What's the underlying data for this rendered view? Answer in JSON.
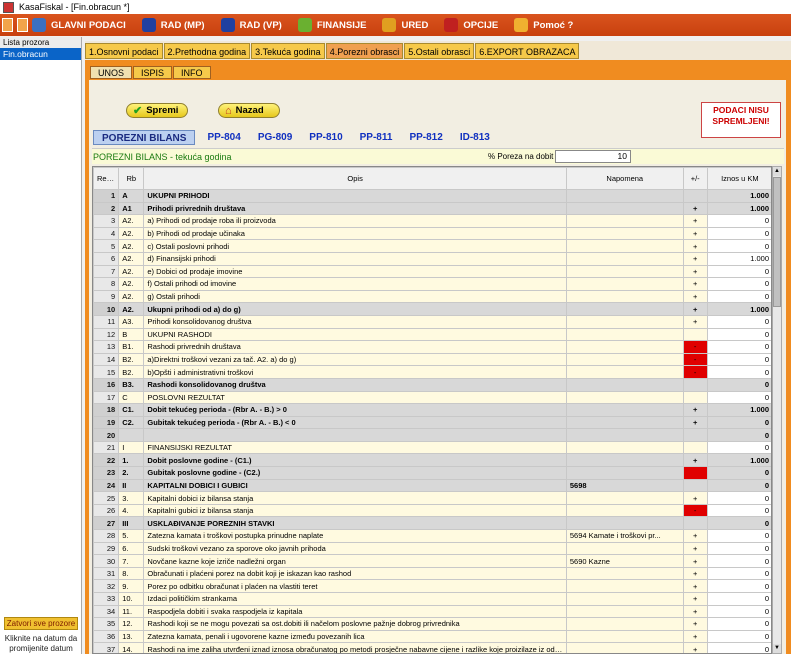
{
  "window": {
    "title": "KasaFiskal - [Fin.obracun *]"
  },
  "menu": [
    {
      "label": "GLAVNI PODACI",
      "icon": "database-icon",
      "color": "#3a70c0"
    },
    {
      "label": "RAD (MP)",
      "icon": "flag-icon",
      "color": "#2040a0"
    },
    {
      "label": "RAD (VP)",
      "icon": "flag-icon",
      "color": "#2040a0"
    },
    {
      "label": "FINANSIJE",
      "icon": "money-icon",
      "color": "#6ab030"
    },
    {
      "label": "URED",
      "icon": "folder-icon",
      "color": "#e0a020"
    },
    {
      "label": "OPCIJE",
      "icon": "gear-icon",
      "color": "#c02020"
    },
    {
      "label": "Pomoć ?",
      "icon": "help-icon",
      "color": "#f0b030"
    }
  ],
  "sidebar": {
    "header": "Lista prozora",
    "items": [
      "Fin.obracun"
    ],
    "close_all": "Zatvori sve prozore",
    "hint": "Kliknite na datum da promijenite datum"
  },
  "tabs_main": [
    "1.Osnovni podaci",
    "2.Prethodna godina",
    "3.Tekuća godina",
    "4.Porezni obrasci",
    "5.Ostali obrasci",
    "6.EXPORT OBRAZACA"
  ],
  "tabs_sub": [
    "UNOS",
    "ISPIS",
    "INFO"
  ],
  "buttons": {
    "save": "Spremi",
    "back": "Nazad"
  },
  "warning": "PODACI NISU SPREMLJENI!",
  "forms": [
    "POREZNI BILANS",
    "PP-804",
    "PG-809",
    "PP-810",
    "PP-811",
    "PP-812",
    "ID-813"
  ],
  "section_title": "POREZNI BILANS - tekuća godina",
  "tax_rate": {
    "label": "% Poreza na dobit",
    "value": "10"
  },
  "columns": {
    "red_br": "Red br.",
    "rb": "Rb",
    "opis": "Opis",
    "napomena": "Napomena",
    "pm": "+/-",
    "iznos": "Iznos u KM"
  },
  "rows": [
    {
      "n": "1",
      "rb": "A",
      "opis": "UKUPNI PRIHODI",
      "napomena": "",
      "pm": "",
      "iznos": "1.000",
      "bold": true
    },
    {
      "n": "2",
      "rb": "A1",
      "opis": "Prihodi privrednih društava",
      "napomena": "",
      "pm": "+",
      "iznos": "1.000",
      "bold": true
    },
    {
      "n": "3",
      "rb": "A2.",
      "opis": "a) Prihodi od prodaje roba ili proizvoda",
      "napomena": "",
      "pm": "+",
      "iznos": "0"
    },
    {
      "n": "4",
      "rb": "A2.",
      "opis": "b) Prihodi od prodaje učinaka",
      "napomena": "",
      "pm": "+",
      "iznos": "0"
    },
    {
      "n": "5",
      "rb": "A2.",
      "opis": "c) Ostali poslovni prihodi",
      "napomena": "",
      "pm": "+",
      "iznos": "0"
    },
    {
      "n": "6",
      "rb": "A2.",
      "opis": "d) Finansijski prihodi",
      "napomena": "",
      "pm": "+",
      "iznos": "1.000"
    },
    {
      "n": "7",
      "rb": "A2.",
      "opis": "e) Dobici od prodaje imovine",
      "napomena": "",
      "pm": "+",
      "iznos": "0"
    },
    {
      "n": "8",
      "rb": "A2.",
      "opis": "f) Ostali prihodi od imovine",
      "napomena": "",
      "pm": "+",
      "iznos": "0"
    },
    {
      "n": "9",
      "rb": "A2.",
      "opis": "g) Ostali prihodi",
      "napomena": "",
      "pm": "+",
      "iznos": "0"
    },
    {
      "n": "10",
      "rb": "A2.",
      "opis": "Ukupni prihodi  od a) do g)",
      "napomena": "",
      "pm": "+",
      "iznos": "1.000",
      "bold": true
    },
    {
      "n": "11",
      "rb": "A3.",
      "opis": "Prihodi konsolidovanog društva",
      "napomena": "",
      "pm": "+",
      "iznos": "0"
    },
    {
      "n": "12",
      "rb": "B",
      "opis": "UKUPNI RASHODI",
      "napomena": "",
      "pm": "",
      "iznos": "0"
    },
    {
      "n": "13",
      "rb": "B1.",
      "opis": "Rashodi privrednih društava",
      "napomena": "",
      "pm": "-",
      "iznos": "0",
      "red": true
    },
    {
      "n": "14",
      "rb": "B2.",
      "opis": "a)Direktni troškovi vezani za tač. A2. a) do g)",
      "napomena": "",
      "pm": "-",
      "iznos": "0",
      "red": true
    },
    {
      "n": "15",
      "rb": "B2.",
      "opis": "b)Opšti i administrativni troškovi",
      "napomena": "",
      "pm": "-",
      "iznos": "0",
      "red": true
    },
    {
      "n": "16",
      "rb": "B3.",
      "opis": "Rashodi konsolidovanog društva",
      "napomena": "",
      "pm": "",
      "iznos": "0",
      "bold": true
    },
    {
      "n": "17",
      "rb": "C",
      "opis": "POSLOVNI REZULTAT",
      "napomena": "",
      "pm": "",
      "iznos": "0"
    },
    {
      "n": "18",
      "rb": "C1.",
      "opis": "Dobit tekućeg perioda  - (Rbr A. - B.) > 0",
      "napomena": "",
      "pm": "+",
      "iznos": "1.000",
      "bold": true
    },
    {
      "n": "19",
      "rb": "C2.",
      "opis": "Gubitak tekućeg perioda  - (Rbr A. - B.) < 0",
      "napomena": "",
      "pm": "+",
      "iznos": "0",
      "bold": true
    },
    {
      "n": "20",
      "rb": "",
      "opis": "",
      "napomena": "",
      "pm": "",
      "iznos": "0",
      "bold": true
    },
    {
      "n": "21",
      "rb": "I",
      "opis": "FINANSIJSKI REZULTAT",
      "napomena": "",
      "pm": "",
      "iznos": "0"
    },
    {
      "n": "22",
      "rb": "1.",
      "opis": "Dobit poslovne godine  -     (C1.)",
      "napomena": "",
      "pm": "+",
      "iznos": "1.000",
      "bold": true
    },
    {
      "n": "23",
      "rb": "2.",
      "opis": "Gubitak poslovne godine  -     (C2.)",
      "napomena": "",
      "pm": "",
      "iznos": "0",
      "bold": true,
      "red": true
    },
    {
      "n": "24",
      "rb": "II",
      "opis": "KAPITALNI DOBICI I GUBICI",
      "napomena": "5698",
      "pm": "",
      "iznos": "0",
      "bold": true
    },
    {
      "n": "25",
      "rb": "3.",
      "opis": "Kapitalni dobici iz bilansa stanja",
      "napomena": "",
      "pm": "+",
      "iznos": "0"
    },
    {
      "n": "26",
      "rb": "4.",
      "opis": "Kapitalni gubici iz bilansa stanja",
      "napomena": "",
      "pm": "-",
      "iznos": "0",
      "red": true
    },
    {
      "n": "27",
      "rb": "III",
      "opis": "USKLAĐIVANJE POREZNIH STAVKI",
      "napomena": "",
      "pm": "",
      "iznos": "0",
      "bold": true
    },
    {
      "n": "28",
      "rb": "5.",
      "opis": "Zatezna kamata i troškovi postupka prinudne naplate",
      "napomena": "5694 Kamate i troškovi pr...",
      "pm": "+",
      "iznos": "0"
    },
    {
      "n": "29",
      "rb": "6.",
      "opis": "Sudski troškovi vezano za sporove oko javnih prihoda",
      "napomena": "",
      "pm": "+",
      "iznos": "0"
    },
    {
      "n": "30",
      "rb": "7.",
      "opis": "Novčane kazne koje izriče nadležni organ",
      "napomena": "5690 Kazne",
      "pm": "+",
      "iznos": "0"
    },
    {
      "n": "31",
      "rb": "8.",
      "opis": "Obračunati i plaćeni porez na dobit koji je iskazan kao rashod",
      "napomena": "",
      "pm": "+",
      "iznos": "0"
    },
    {
      "n": "32",
      "rb": "9.",
      "opis": "Porez po odbitku obračunat i plaćen na vlastiti teret",
      "napomena": "",
      "pm": "+",
      "iznos": "0"
    },
    {
      "n": "33",
      "rb": "10.",
      "opis": "Izdaci političkim strankama",
      "napomena": "",
      "pm": "+",
      "iznos": "0"
    },
    {
      "n": "34",
      "rb": "11.",
      "opis": "Raspodjela dobiti i svaka raspodjela iz kapitala",
      "napomena": "",
      "pm": "+",
      "iznos": "0"
    },
    {
      "n": "35",
      "rb": "12.",
      "opis": "Rashodi koji se ne mogu povezati sa ost.dobiti ili načelom poslovne pažnje dobrog privrednika",
      "napomena": "",
      "pm": "+",
      "iznos": "0"
    },
    {
      "n": "36",
      "rb": "13.",
      "opis": "Zatezna kamata, penali i ugovorene kazne između povezanih lica",
      "napomena": "",
      "pm": "+",
      "iznos": "0"
    },
    {
      "n": "37",
      "rb": "14.",
      "opis": "Rashodi na ime zaliha utvrđeni iznad iznosa obračunatog po metodi prosječne nabavne cijene i razlike koje proizilaze iz odstupanja",
      "napomena": "",
      "pm": "+",
      "iznos": "0"
    }
  ]
}
